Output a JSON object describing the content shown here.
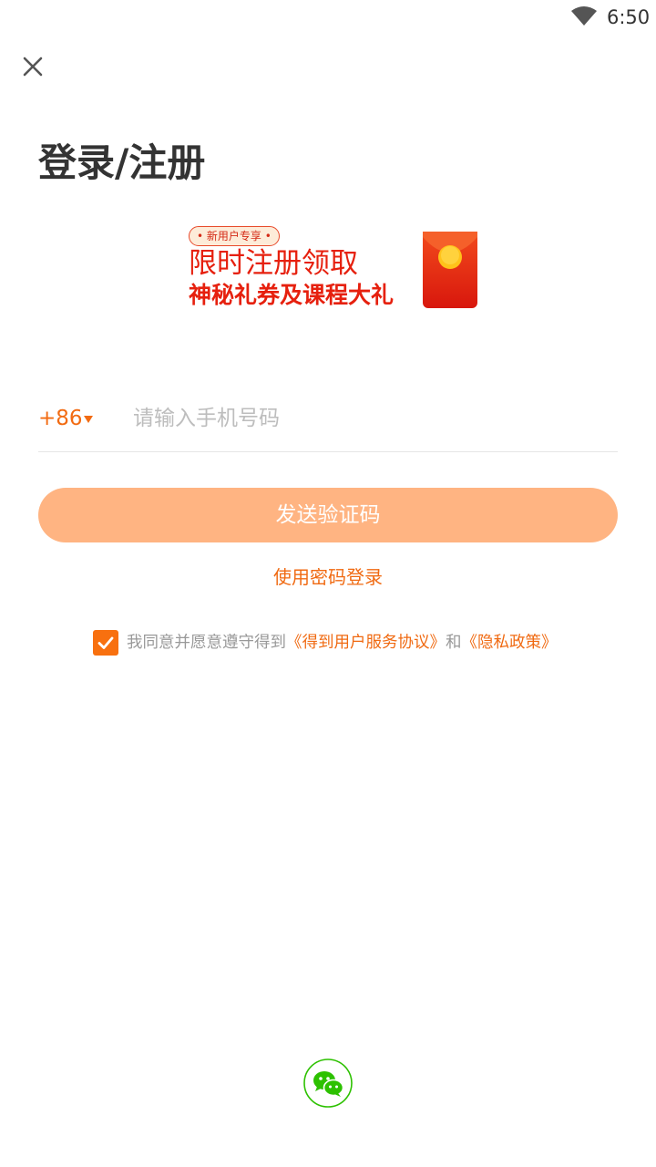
{
  "status_bar": {
    "time": "6:50",
    "wifi_icon": "wifi-icon"
  },
  "header": {
    "close_icon": "close-icon",
    "title": "登录/注册"
  },
  "promo": {
    "badge": "• 新用户专享 •",
    "line1": "限时注册领取",
    "line2": "神秘礼券及课程大礼",
    "icon": "red-envelope-icon"
  },
  "phone": {
    "country_code": "+86",
    "dropdown_icon": "caret-down-icon",
    "value": "",
    "placeholder": "请输入手机号码"
  },
  "send_code_button": "发送验证码",
  "password_login_link": "使用密码登录",
  "agreement": {
    "checked": true,
    "prefix": "我同意并愿意遵守得到",
    "terms_link": "《得到用户服务协议》",
    "conjunction": "和",
    "privacy_link": "《隐私政策》"
  },
  "third_party": {
    "wechat_icon": "wechat-icon"
  },
  "colors": {
    "accent": "#f06a12",
    "button_disabled": "#ffb482",
    "promo_red": "#e6200e",
    "wechat_green": "#2dc100"
  }
}
